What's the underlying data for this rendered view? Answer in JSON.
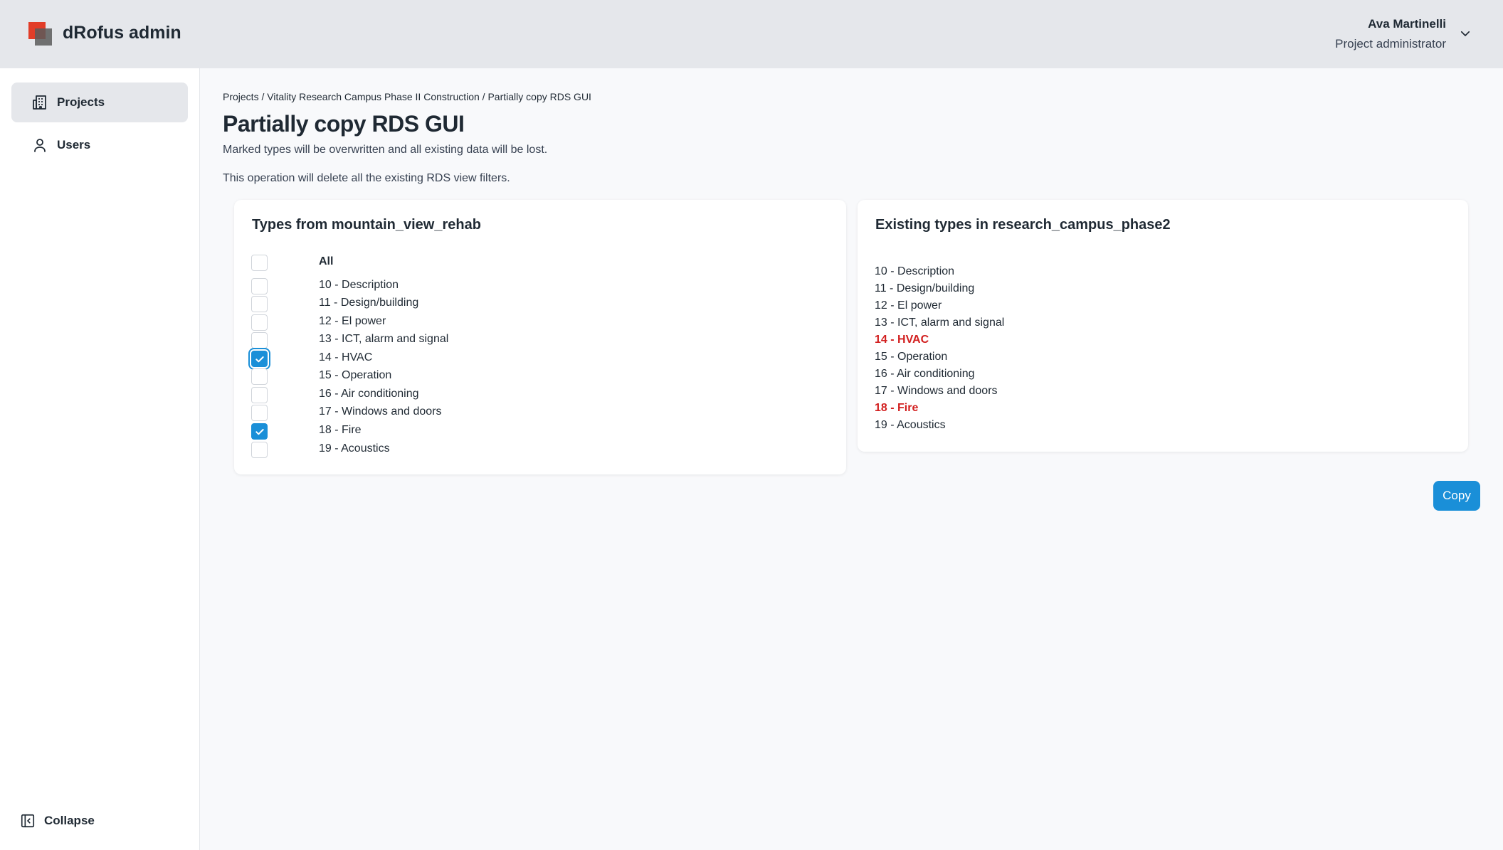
{
  "app": {
    "title": "dRofus admin"
  },
  "user": {
    "name": "Ava Martinelli",
    "role": "Project administrator"
  },
  "sidebar": {
    "items": [
      {
        "label": "Projects",
        "icon": "building-icon",
        "active": true
      },
      {
        "label": "Users",
        "icon": "user-icon",
        "active": false
      }
    ],
    "collapse_label": "Collapse"
  },
  "breadcrumb": [
    "Projects",
    "Vitality Research Campus Phase II Construction",
    "Partially copy RDS GUI"
  ],
  "breadcrumb_separator": " / ",
  "page": {
    "title": "Partially copy RDS GUI",
    "desc1": "Marked types will be overwritten and all existing data will be lost.",
    "desc2": "This operation will delete all the existing RDS view filters."
  },
  "source_panel": {
    "title": "Types from mountain_view_rehab",
    "all_label": "All",
    "all_checked": false,
    "types": [
      {
        "label": "10 - Description",
        "checked": false
      },
      {
        "label": "11 - Design/building",
        "checked": false
      },
      {
        "label": "12 - El power",
        "checked": false
      },
      {
        "label": "13 - ICT, alarm and signal",
        "checked": false
      },
      {
        "label": "14 - HVAC",
        "checked": true
      },
      {
        "label": "15 - Operation",
        "checked": false
      },
      {
        "label": "16 - Air conditioning",
        "checked": false
      },
      {
        "label": "17 - Windows and doors",
        "checked": false
      },
      {
        "label": "18 - Fire",
        "checked": true
      },
      {
        "label": "19 - Acoustics",
        "checked": false
      }
    ]
  },
  "target_panel": {
    "title": "Existing types in research_campus_phase2",
    "types": [
      {
        "label": "10 - Description",
        "marked": false
      },
      {
        "label": "11 - Design/building",
        "marked": false
      },
      {
        "label": "12 - El power",
        "marked": false
      },
      {
        "label": "13 - ICT, alarm and signal",
        "marked": false
      },
      {
        "label": "14 - HVAC",
        "marked": true
      },
      {
        "label": "15 - Operation",
        "marked": false
      },
      {
        "label": "16 - Air conditioning",
        "marked": false
      },
      {
        "label": "17 - Windows and doors",
        "marked": false
      },
      {
        "label": "18 - Fire",
        "marked": true
      },
      {
        "label": "19 - Acoustics",
        "marked": false
      }
    ]
  },
  "actions": {
    "copy_label": "Copy"
  },
  "colors": {
    "accent": "#1a8fd8",
    "marked": "#d21f1f",
    "brand": "#e23d28"
  }
}
